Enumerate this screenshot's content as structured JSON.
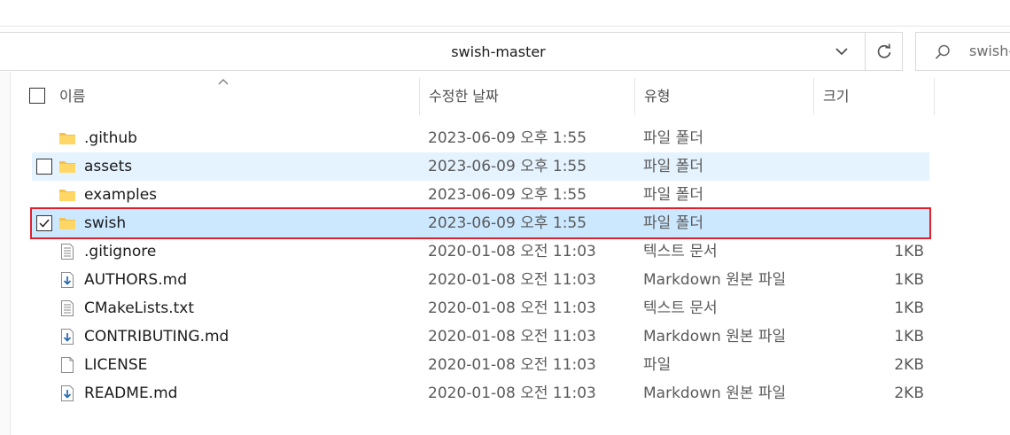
{
  "address": {
    "path": "swish-master"
  },
  "search": {
    "placeholder": "swish-"
  },
  "columns": {
    "name": "이름",
    "modified": "수정한 날짜",
    "type": "유형",
    "size": "크기"
  },
  "files": [
    {
      "name": ".github",
      "modified": "2023-06-09 오후 1:55",
      "type": "파일 폴더",
      "size": "",
      "icon": "folder-icon"
    },
    {
      "name": "assets",
      "modified": "2023-06-09 오후 1:55",
      "type": "파일 폴더",
      "size": "",
      "icon": "folder-icon"
    },
    {
      "name": "examples",
      "modified": "2023-06-09 오후 1:55",
      "type": "파일 폴더",
      "size": "",
      "icon": "folder-icon"
    },
    {
      "name": "swish",
      "modified": "2023-06-09 오후 1:55",
      "type": "파일 폴더",
      "size": "",
      "icon": "folder-icon"
    },
    {
      "name": ".gitignore",
      "modified": "2020-01-08 오전 11:03",
      "type": "텍스트 문서",
      "size": "1KB",
      "icon": "text-file-icon"
    },
    {
      "name": "AUTHORS.md",
      "modified": "2020-01-08 오전 11:03",
      "type": "Markdown 원본 파일",
      "size": "1KB",
      "icon": "markdown-file-icon"
    },
    {
      "name": "CMakeLists.txt",
      "modified": "2020-01-08 오전 11:03",
      "type": "텍스트 문서",
      "size": "1KB",
      "icon": "text-file-icon"
    },
    {
      "name": "CONTRIBUTING.md",
      "modified": "2020-01-08 오전 11:03",
      "type": "Markdown 원본 파일",
      "size": "1KB",
      "icon": "markdown-file-icon"
    },
    {
      "name": "LICENSE",
      "modified": "2020-01-08 오전 11:03",
      "type": "파일",
      "size": "2KB",
      "icon": "blank-file-icon"
    },
    {
      "name": "README.md",
      "modified": "2020-01-08 오전 11:03",
      "type": "Markdown 원본 파일",
      "size": "2KB",
      "icon": "markdown-file-icon"
    }
  ],
  "colors": {
    "selection_bg": "#cce8ff",
    "hover_bg": "#e5f3ff",
    "highlight_border": "#e0202a",
    "folder": "#f2c14e"
  }
}
